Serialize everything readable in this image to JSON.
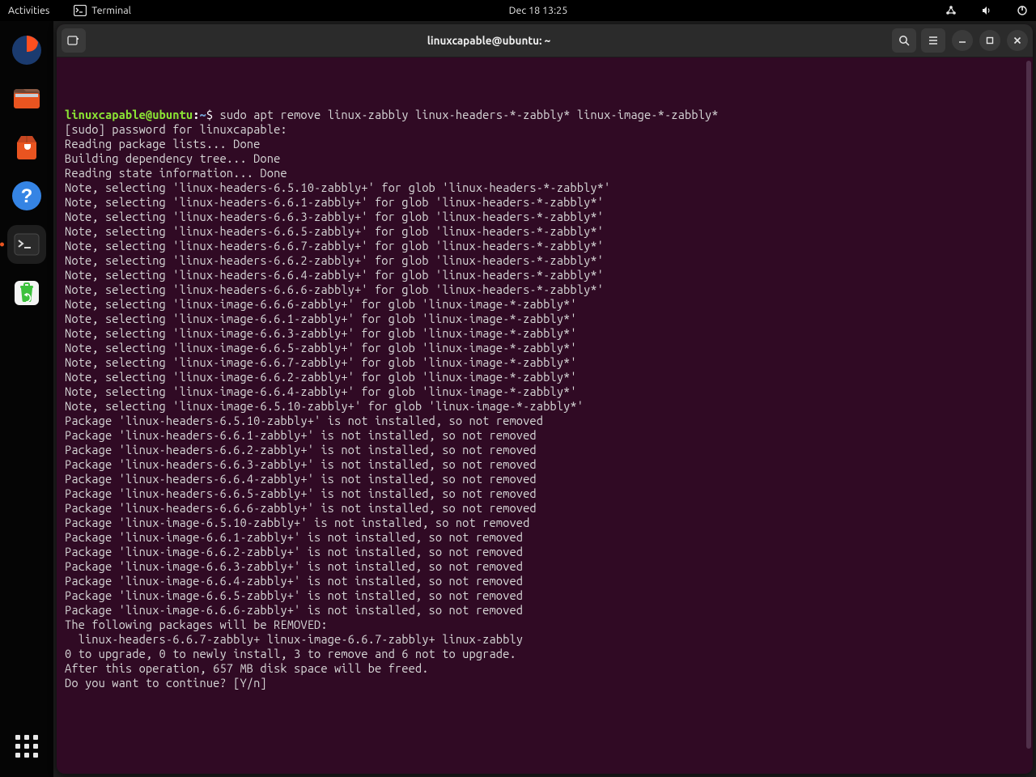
{
  "topbar": {
    "activities": "Activities",
    "app_name": "Terminal",
    "clock": "Dec 18  13:25"
  },
  "window": {
    "title": "linuxcapable@ubuntu: ~"
  },
  "prompt": {
    "user_host": "linuxcapable@ubuntu",
    "colon": ":",
    "path": "~",
    "symbol": "$"
  },
  "command": "sudo apt remove linux-zabbly linux-headers-*-zabbly* linux-image-*-zabbly*",
  "output_lines": [
    "[sudo] password for linuxcapable:",
    "Reading package lists... Done",
    "Building dependency tree... Done",
    "Reading state information... Done",
    "Note, selecting 'linux-headers-6.5.10-zabbly+' for glob 'linux-headers-*-zabbly*'",
    "Note, selecting 'linux-headers-6.6.1-zabbly+' for glob 'linux-headers-*-zabbly*'",
    "Note, selecting 'linux-headers-6.6.3-zabbly+' for glob 'linux-headers-*-zabbly*'",
    "Note, selecting 'linux-headers-6.6.5-zabbly+' for glob 'linux-headers-*-zabbly*'",
    "Note, selecting 'linux-headers-6.6.7-zabbly+' for glob 'linux-headers-*-zabbly*'",
    "Note, selecting 'linux-headers-6.6.2-zabbly+' for glob 'linux-headers-*-zabbly*'",
    "Note, selecting 'linux-headers-6.6.4-zabbly+' for glob 'linux-headers-*-zabbly*'",
    "Note, selecting 'linux-headers-6.6.6-zabbly+' for glob 'linux-headers-*-zabbly*'",
    "Note, selecting 'linux-image-6.6.6-zabbly+' for glob 'linux-image-*-zabbly*'",
    "Note, selecting 'linux-image-6.6.1-zabbly+' for glob 'linux-image-*-zabbly*'",
    "Note, selecting 'linux-image-6.6.3-zabbly+' for glob 'linux-image-*-zabbly*'",
    "Note, selecting 'linux-image-6.6.5-zabbly+' for glob 'linux-image-*-zabbly*'",
    "Note, selecting 'linux-image-6.6.7-zabbly+' for glob 'linux-image-*-zabbly*'",
    "Note, selecting 'linux-image-6.6.2-zabbly+' for glob 'linux-image-*-zabbly*'",
    "Note, selecting 'linux-image-6.6.4-zabbly+' for glob 'linux-image-*-zabbly*'",
    "Note, selecting 'linux-image-6.5.10-zabbly+' for glob 'linux-image-*-zabbly*'",
    "Package 'linux-headers-6.5.10-zabbly+' is not installed, so not removed",
    "Package 'linux-headers-6.6.1-zabbly+' is not installed, so not removed",
    "Package 'linux-headers-6.6.2-zabbly+' is not installed, so not removed",
    "Package 'linux-headers-6.6.3-zabbly+' is not installed, so not removed",
    "Package 'linux-headers-6.6.4-zabbly+' is not installed, so not removed",
    "Package 'linux-headers-6.6.5-zabbly+' is not installed, so not removed",
    "Package 'linux-headers-6.6.6-zabbly+' is not installed, so not removed",
    "Package 'linux-image-6.5.10-zabbly+' is not installed, so not removed",
    "Package 'linux-image-6.6.1-zabbly+' is not installed, so not removed",
    "Package 'linux-image-6.6.2-zabbly+' is not installed, so not removed",
    "Package 'linux-image-6.6.3-zabbly+' is not installed, so not removed",
    "Package 'linux-image-6.6.4-zabbly+' is not installed, so not removed",
    "Package 'linux-image-6.6.5-zabbly+' is not installed, so not removed",
    "Package 'linux-image-6.6.6-zabbly+' is not installed, so not removed",
    "The following packages will be REMOVED:",
    "  linux-headers-6.6.7-zabbly+ linux-image-6.6.7-zabbly+ linux-zabbly",
    "0 to upgrade, 0 to newly install, 3 to remove and 6 not to upgrade.",
    "After this operation, 657 MB disk space will be freed.",
    "Do you want to continue? [Y/n]"
  ]
}
